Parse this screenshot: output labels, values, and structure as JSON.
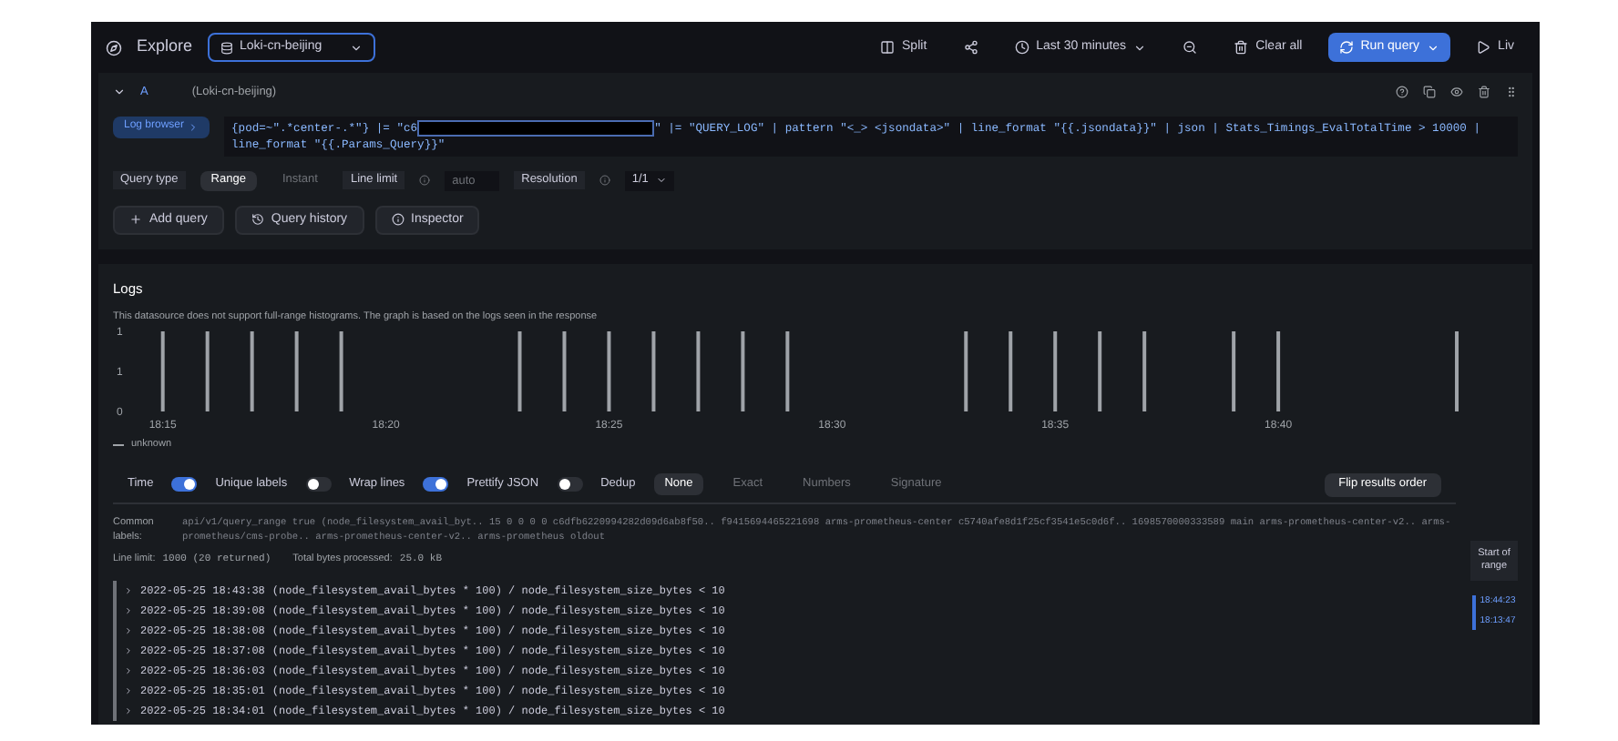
{
  "toolbar": {
    "title": "Explore",
    "datasource": "Loki-cn-beijing",
    "items": [
      {
        "kind": "split",
        "label": "Split"
      },
      {
        "kind": "share"
      },
      {
        "kind": "time",
        "label": "Last 30 minutes"
      },
      {
        "kind": "zoom"
      },
      {
        "kind": "clear",
        "label": "Clear all"
      },
      {
        "kind": "run",
        "label": "Run query"
      },
      {
        "kind": "live",
        "label": "Liv"
      }
    ]
  },
  "query": {
    "letter": "A",
    "datasource": "(Loki-cn-beijing)",
    "browser": "Log browser",
    "line1_before": "{pod=~\".*center-.*\"} |= \"c6",
    "redacted": true,
    "line1_after": "\" |= \"QUERY_LOG\" | pattern \"<_> <jsondata>\" | line_format \"{{.jsondata}}\" | json | Stats_Timings_EvalTotalTime > 10000 |",
    "line2": "line_format \"{{.Params_Query}}\"",
    "query_type": {
      "label": "Query type",
      "options": [
        {
          "label": "Range",
          "selected": true
        },
        {
          "label": "Instant",
          "selected": false
        }
      ]
    },
    "line_limit": {
      "label": "Line limit",
      "placeholder": "auto"
    },
    "resolution": {
      "label": "Resolution",
      "value": "1/1"
    }
  },
  "actions": [
    {
      "kind": "add",
      "label": "Add query"
    },
    {
      "kind": "history",
      "label": "Query history"
    },
    {
      "kind": "inspector",
      "label": "Inspector"
    }
  ],
  "logs": {
    "title": "Logs",
    "notice": "This datasource does not support full-range histograms. The graph is based on the logs seen in the response",
    "chart_data": {
      "type": "bar",
      "categories": [
        "18:15",
        null,
        null,
        null,
        null,
        "18:20",
        null,
        null,
        null,
        null,
        "18:25",
        null,
        null,
        null,
        null,
        "18:30",
        null,
        null,
        null,
        null,
        "18:35",
        null,
        null,
        null,
        null,
        "18:40",
        null,
        null,
        null,
        null
      ],
      "series": [
        {
          "name": "unknown",
          "color": "#9fa3a8",
          "values": [
            1,
            1,
            1,
            1,
            1,
            null,
            null,
            null,
            1,
            1,
            1,
            1,
            1,
            1,
            1,
            null,
            null,
            null,
            1,
            1,
            1,
            1,
            1,
            null,
            1,
            1,
            null,
            null,
            null,
            1
          ]
        }
      ],
      "ylim": [
        0,
        1
      ],
      "yticks": [
        {
          "value": 0,
          "label": "0"
        },
        {
          "value": 0.5,
          "label": "1"
        },
        {
          "value": 1,
          "label": "1"
        }
      ]
    },
    "toggles": [
      {
        "label": "Time",
        "on": true
      },
      {
        "label": "Unique labels",
        "on": false
      },
      {
        "label": "Wrap lines",
        "on": true
      },
      {
        "label": "Prettify JSON",
        "on": false
      }
    ],
    "dedup": {
      "label": "Dedup",
      "options": [
        {
          "label": "None",
          "selected": true
        },
        {
          "label": "Exact",
          "selected": false
        },
        {
          "label": "Numbers",
          "selected": false
        },
        {
          "label": "Signature",
          "selected": false
        }
      ]
    },
    "flip": "Flip results order",
    "common_labels": {
      "label": "Common labels:",
      "value": "api/v1/query_range true (node_filesystem_avail_byt.. 15 0 0 0 0 c6dfb6220994282d09d6ab8f50.. f9415694465221698 arms-prometheus-center c5740afe8d1f25cf3541e5c0d6f.. 1698570000333589 main arms-prometheus-center-v2.. arms-prometheus/cms-probe.. arms-prometheus-center-v2.. arms-prometheus oldout"
    },
    "stats": [
      {
        "label": "Line limit:",
        "value": "1000 (20 returned)"
      },
      {
        "label": "Total bytes processed:",
        "value": "25.0 kB"
      }
    ],
    "rows": [
      {
        "timestamp": "2022-05-25 18:43:38",
        "message": "(node_filesystem_avail_bytes * 100) / node_filesystem_size_bytes < 10"
      },
      {
        "timestamp": "2022-05-25 18:39:08",
        "message": "(node_filesystem_avail_bytes * 100) / node_filesystem_size_bytes < 10"
      },
      {
        "timestamp": "2022-05-25 18:38:08",
        "message": "(node_filesystem_avail_bytes * 100) / node_filesystem_size_bytes < 10"
      },
      {
        "timestamp": "2022-05-25 18:37:08",
        "message": "(node_filesystem_avail_bytes * 100) / node_filesystem_size_bytes < 10"
      },
      {
        "timestamp": "2022-05-25 18:36:03",
        "message": "(node_filesystem_avail_bytes * 100) / node_filesystem_size_bytes < 10"
      },
      {
        "timestamp": "2022-05-25 18:35:01",
        "message": "(node_filesystem_avail_bytes * 100) / node_filesystem_size_bytes < 10"
      },
      {
        "timestamp": "2022-05-25 18:34:01",
        "message": "(node_filesystem_avail_bytes * 100) / node_filesystem_size_bytes < 10"
      }
    ],
    "navigator": {
      "start": "Start of range",
      "range_end": "18:44:23",
      "range_start": "18:13:47"
    }
  }
}
